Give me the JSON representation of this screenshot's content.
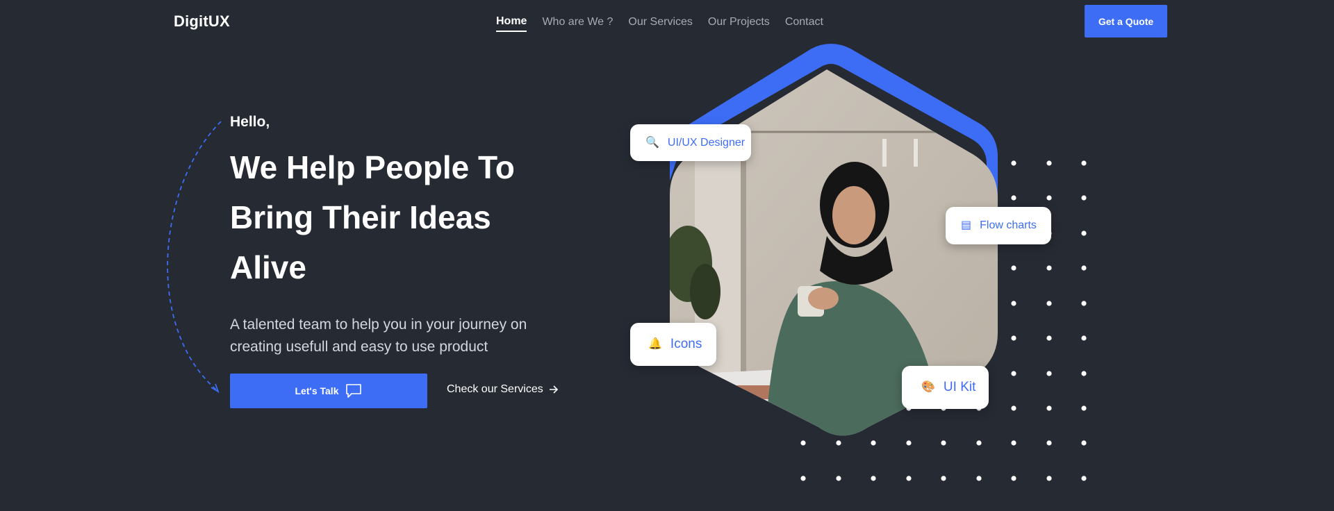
{
  "brand": {
    "logo": "DigitUX"
  },
  "nav": {
    "items": [
      {
        "label": "Home",
        "active": true
      },
      {
        "label": "Who are We ?"
      },
      {
        "label": "Our Services"
      },
      {
        "label": "Our Projects"
      },
      {
        "label": "Contact"
      }
    ],
    "cta_label": "Get a Quote"
  },
  "hero": {
    "greeting": "Hello,",
    "headline_lines": [
      "We Help People To",
      "Bring Their Ideas",
      "Alive"
    ],
    "subtext_lines": [
      "A talented team to help you in your journey on",
      "creating usefull and easy to use product"
    ],
    "primary_button": "Let's Talk",
    "secondary_link": "Check our Services"
  },
  "tags": [
    {
      "label": "UI/UX Designer",
      "icon": "magnifier-icon"
    },
    {
      "label": "Flow charts",
      "icon": "flowchart-icon"
    },
    {
      "label": "Icons",
      "icon": "bell-icon"
    },
    {
      "label": "UI Kit",
      "icon": "palette-icon"
    }
  ],
  "colors": {
    "background": "#262a33",
    "accent": "#3d6df5",
    "text": "#ffffff",
    "muted": "#a7abb4"
  }
}
